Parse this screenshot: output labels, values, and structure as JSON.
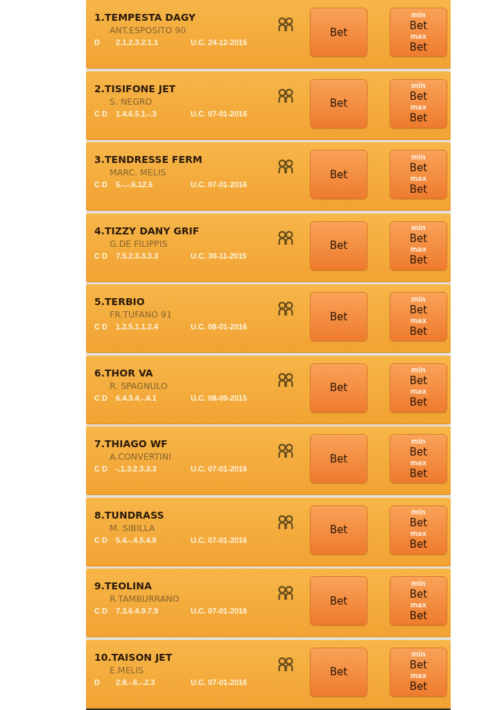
{
  "horses": [
    {
      "title": "1.TEMPESTA DAGY",
      "jockey": "ANT.ESPOSITO 90",
      "tags": "D",
      "form": "2.1.2.3.2.1.1",
      "last_race": "U.C. 24-12-2015",
      "bet": "Bet",
      "min_label": "min",
      "min_bet": "Bet",
      "max_label": "max",
      "max_bet": "Bet"
    },
    {
      "title": "2.TISIFONE JET",
      "jockey": "S. NEGRO",
      "tags": "C D",
      "form": "1.4.6.5.1.-.3",
      "last_race": "U.C. 07-01-2016",
      "bet": "Bet",
      "min_label": "min",
      "min_bet": "Bet",
      "max_label": "max",
      "max_bet": "Bet"
    },
    {
      "title": "3.TENDRESSE FERM",
      "jockey": "MARC. MELIS",
      "tags": "C D",
      "form": "5.-.-.6.12.6",
      "last_race": "U.C. 07-01-2016",
      "bet": "Bet",
      "min_label": "min",
      "min_bet": "Bet",
      "max_label": "max",
      "max_bet": "Bet"
    },
    {
      "title": "4.TIZZY DANY GRIF",
      "jockey": "G.DE FILIPPIS",
      "tags": "C D",
      "form": "7.5.2.3.3.3.3",
      "last_race": "U.C. 30-11-2015",
      "bet": "Bet",
      "min_label": "min",
      "min_bet": "Bet",
      "max_label": "max",
      "max_bet": "Bet"
    },
    {
      "title": "5.TERBIO",
      "jockey": "FR.TUFANO 91",
      "tags": "C D",
      "form": "1.2.5.1.1.2.4",
      "last_race": "U.C. 08-01-2016",
      "bet": "Bet",
      "min_label": "min",
      "min_bet": "Bet",
      "max_label": "max",
      "max_bet": "Bet"
    },
    {
      "title": "6.THOR VA",
      "jockey": "R. SPAGNULO",
      "tags": "C D",
      "form": "6.4.3.4.-.4.1",
      "last_race": "U.C. 08-09-2015",
      "bet": "Bet",
      "min_label": "min",
      "min_bet": "Bet",
      "max_label": "max",
      "max_bet": "Bet"
    },
    {
      "title": "7.THIAGO WF",
      "jockey": "A.CONVERTINI",
      "tags": "C D",
      "form": "-.1.3.2.3.3.3",
      "last_race": "U.C. 07-01-2016",
      "bet": "Bet",
      "min_label": "min",
      "min_bet": "Bet",
      "max_label": "max",
      "max_bet": "Bet"
    },
    {
      "title": "8.TUNDRASS",
      "jockey": "M. SIBILLA",
      "tags": "C D",
      "form": "5.4.-.4.5.4.8",
      "last_race": "U.C. 07-01-2016",
      "bet": "Bet",
      "min_label": "min",
      "min_bet": "Bet",
      "max_label": "max",
      "max_bet": "Bet"
    },
    {
      "title": "9.TEOLINA",
      "jockey": "R.TAMBURRANO",
      "tags": "C D",
      "form": "7.3.6.4.9.7.9",
      "last_race": "U.C. 07-01-2016",
      "bet": "Bet",
      "min_label": "min",
      "min_bet": "Bet",
      "max_label": "max",
      "max_bet": "Bet"
    },
    {
      "title": "10.TAISON JET",
      "jockey": "E.MELIS",
      "tags": "D",
      "form": "2.9.-.6.-.2.3",
      "last_race": "U.C. 07-01-2016",
      "bet": "Bet",
      "min_label": "min",
      "min_bet": "Bet",
      "max_label": "max",
      "max_bet": "Bet"
    }
  ]
}
